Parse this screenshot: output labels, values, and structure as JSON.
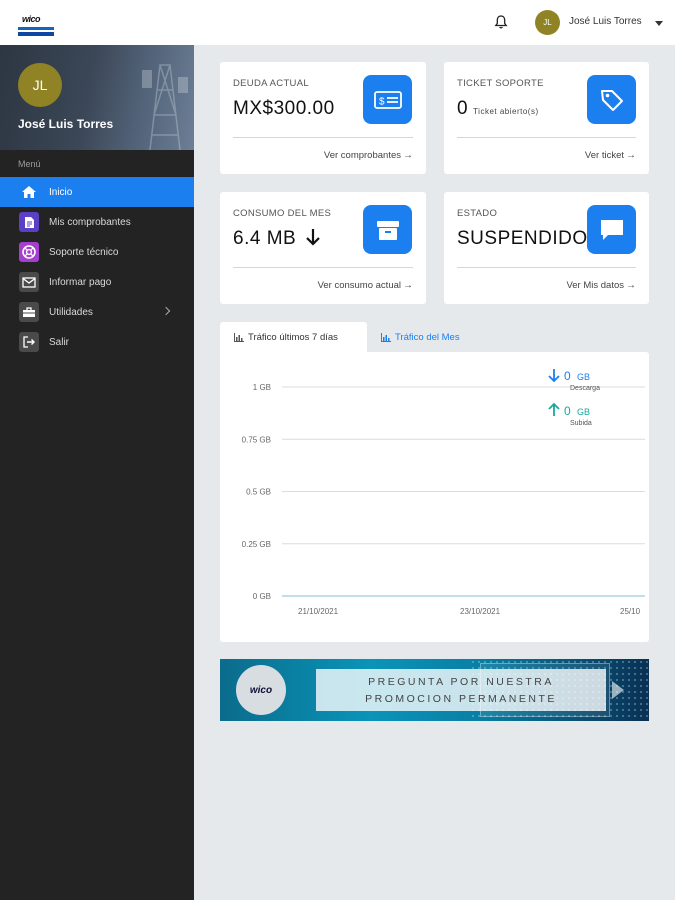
{
  "header": {
    "logo_text": "wico",
    "user_initials": "JL",
    "user_name": "José Luis Torres"
  },
  "sidebar": {
    "profile_initials": "JL",
    "profile_name": "José Luis Torres",
    "menu_label": "Menú",
    "items": [
      {
        "label": "Inicio",
        "icon": "home-icon",
        "active": true
      },
      {
        "label": "Mis comprobantes",
        "icon": "document-icon",
        "active": false
      },
      {
        "label": "Soporte técnico",
        "icon": "support-icon",
        "active": false
      },
      {
        "label": "Informar pago",
        "icon": "mail-icon",
        "active": false
      },
      {
        "label": "Utilidades",
        "icon": "toolbox-icon",
        "active": false,
        "has_submenu": true
      },
      {
        "label": "Salir",
        "icon": "logout-icon",
        "active": false
      }
    ]
  },
  "cards": {
    "deuda": {
      "title": "DEUDA ACTUAL",
      "value": "MX$300.00",
      "link": "Ver comprobantes",
      "icon": "money-icon"
    },
    "ticket": {
      "title": "TICKET SOPORTE",
      "value": "0",
      "sub": "Ticket abierto(s)",
      "link": "Ver ticket",
      "icon": "tag-icon"
    },
    "consumo": {
      "title": "CONSUMO DEL MES",
      "value": "6.4 MB",
      "link": "Ver consumo actual",
      "icon": "archive-icon"
    },
    "estado": {
      "title": "ESTADO",
      "value": "SUSPENDIDO",
      "link": "Ver Mis datos",
      "icon": "chat-icon"
    }
  },
  "tabs": [
    {
      "label": "Tráfico últimos 7 días",
      "active": true
    },
    {
      "label": "Tráfico del Mes",
      "active": false
    }
  ],
  "chart_data": {
    "type": "line",
    "yticks": [
      "1 GB",
      "0.75 GB",
      "0.5 GB",
      "0.25 GB",
      "0 GB"
    ],
    "ylim": [
      0,
      1
    ],
    "xticks": [
      "21/10/2021",
      "23/10/2021",
      "25/10"
    ],
    "series": [
      {
        "name": "Descarga",
        "value": "0",
        "unit": "GB",
        "color": "#1b7ff0"
      },
      {
        "name": "Subida",
        "value": "0",
        "unit": "GB",
        "color": "#1aa79c"
      }
    ]
  },
  "banner": {
    "logo_text": "wico",
    "line1": "PREGUNTA POR NUESTRA",
    "line2": "PROMOCION PERMANENTE"
  },
  "colors": {
    "accent": "#1b7ff0",
    "sidebar_bg": "#232323",
    "avatar": "#8f8325",
    "upload": "#1aa79c"
  }
}
